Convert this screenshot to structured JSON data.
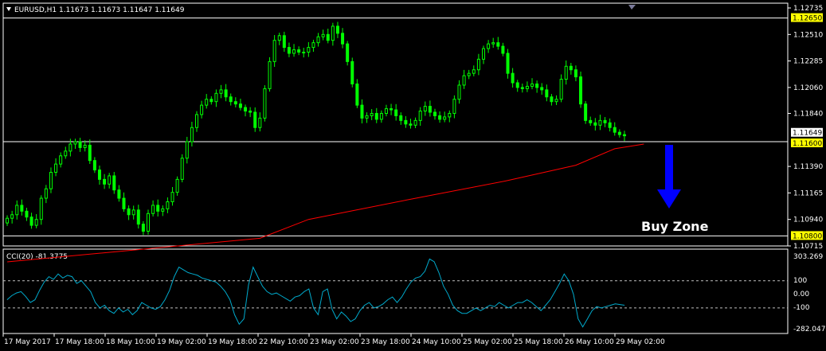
{
  "chart_data": [
    {
      "type": "candlestick",
      "symbol_header": "EURUSD,H1  1.11673 1.11673 1.11647 1.11649",
      "y_ticks": [
        "1.12735",
        "1.12510",
        "1.12285",
        "1.12060",
        "1.11840",
        "1.11390",
        "1.11165",
        "1.10940",
        "1.10715"
      ],
      "ylim": [
        1.10715,
        1.12735
      ],
      "x_ticks": [
        "17 May 2017",
        "17 May 18:00",
        "18 May 10:00",
        "19 May 02:00",
        "19 May 18:00",
        "22 May 10:00",
        "23 May 02:00",
        "23 May 18:00",
        "24 May 10:00",
        "25 May 02:00",
        "25 May 18:00",
        "26 May 10:00",
        "29 May 02:00"
      ],
      "price_labels": [
        {
          "text": "1.12650",
          "value": 1.1265,
          "highlight": true
        },
        {
          "text": "1.11649",
          "value": 1.11649,
          "highlight": false
        },
        {
          "text": "1.11600",
          "value": 1.116,
          "highlight": true
        },
        {
          "text": "1.10800",
          "value": 1.108,
          "highlight": true
        }
      ],
      "horizontal_levels": [
        1.1265,
        1.116,
        1.108
      ],
      "close_series": [
        1.1095,
        1.1098,
        1.1106,
        1.1101,
        1.1096,
        1.1089,
        1.1094,
        1.1112,
        1.112,
        1.1134,
        1.1141,
        1.1148,
        1.1152,
        1.1158,
        1.116,
        1.1155,
        1.1157,
        1.1144,
        1.1136,
        1.1128,
        1.1124,
        1.1131,
        1.1119,
        1.1112,
        1.1103,
        1.1098,
        1.1102,
        1.109,
        1.1084,
        1.1099,
        1.1106,
        1.1101,
        1.1103,
        1.1109,
        1.1117,
        1.1128,
        1.1146,
        1.116,
        1.1172,
        1.1183,
        1.1191,
        1.1196,
        1.1194,
        1.1201,
        1.1204,
        1.1198,
        1.1194,
        1.1192,
        1.1189,
        1.1186,
        1.1185,
        1.1172,
        1.118,
        1.1205,
        1.1228,
        1.1246,
        1.125,
        1.124,
        1.1235,
        1.1238,
        1.1236,
        1.1236,
        1.124,
        1.1244,
        1.1249,
        1.1251,
        1.1246,
        1.1258,
        1.1252,
        1.1243,
        1.1228,
        1.1209,
        1.1191,
        1.118,
        1.1182,
        1.1184,
        1.1179,
        1.1184,
        1.1188,
        1.1187,
        1.1182,
        1.1178,
        1.1175,
        1.1174,
        1.1178,
        1.1186,
        1.119,
        1.1185,
        1.1182,
        1.1179,
        1.1181,
        1.1184,
        1.1196,
        1.1208,
        1.1216,
        1.1218,
        1.1221,
        1.123,
        1.1239,
        1.1243,
        1.1244,
        1.1241,
        1.1235,
        1.1218,
        1.121,
        1.1206,
        1.1205,
        1.1207,
        1.1209,
        1.1206,
        1.1204,
        1.1198,
        1.1194,
        1.1196,
        1.1213,
        1.1224,
        1.1221,
        1.1215,
        1.1192,
        1.1178,
        1.1176,
        1.1174,
        1.1178,
        1.1176,
        1.1172,
        1.1168,
        1.1166,
        1.1165
      ],
      "ma_series": [
        {
          "x": 0,
          "y": 1.1058
        },
        {
          "x": 52,
          "y": 1.1078
        },
        {
          "x": 62,
          "y": 1.1094
        },
        {
          "x": 84,
          "y": 1.1112
        },
        {
          "x": 103,
          "y": 1.1127
        },
        {
          "x": 117,
          "y": 1.114
        },
        {
          "x": 125,
          "y": 1.1154
        },
        {
          "x": 131,
          "y": 1.1158
        }
      ]
    },
    {
      "type": "line",
      "indicator_header": "CCI(20) -81.3775",
      "y_ticks": [
        "303.269",
        "100",
        "0.00",
        "-100",
        "-282.0478"
      ],
      "ylim": [
        -282.0478,
        303.269
      ],
      "dashed_levels": [
        100,
        -100
      ],
      "values": [
        -40,
        -10,
        10,
        20,
        -15,
        -60,
        -40,
        30,
        90,
        130,
        110,
        150,
        120,
        140,
        130,
        80,
        100,
        60,
        20,
        -60,
        -100,
        -80,
        -120,
        -140,
        -100,
        -130,
        -110,
        -150,
        -120,
        -60,
        -80,
        -100,
        -110,
        -90,
        -40,
        30,
        130,
        200,
        180,
        160,
        150,
        140,
        120,
        110,
        100,
        90,
        60,
        20,
        -40,
        -150,
        -220,
        -180,
        70,
        200,
        130,
        60,
        20,
        0,
        10,
        -10,
        -30,
        -50,
        -20,
        -10,
        20,
        40,
        -100,
        -150,
        20,
        40,
        -110,
        -180,
        -130,
        -160,
        -200,
        -180,
        -120,
        -80,
        -60,
        -100,
        -90,
        -70,
        -40,
        -20,
        -60,
        -20,
        40,
        90,
        120,
        130,
        170,
        260,
        240,
        160,
        60,
        0,
        -80,
        -120,
        -140,
        -140,
        -120,
        -100,
        -120,
        -100,
        -80,
        -90,
        -60,
        -80,
        -100,
        -80,
        -60,
        -60,
        -40,
        -60,
        -90,
        -120,
        -80,
        -40,
        20,
        80,
        150,
        100,
        0,
        -180,
        -240,
        -180,
        -120,
        -90,
        -100,
        -90,
        -80,
        -70,
        -75,
        -80
      ]
    }
  ],
  "annotation": {
    "text": "Buy Zone"
  },
  "colors": {
    "background": "#000000",
    "bull_candle": "#00ff00",
    "bear_candle": "#00ff00",
    "moving_average": "#ff0000",
    "cci_line": "#00aacc",
    "arrow": "#0000ff",
    "level_line": "#ffffff",
    "level_label_bg": "#ffff00"
  }
}
